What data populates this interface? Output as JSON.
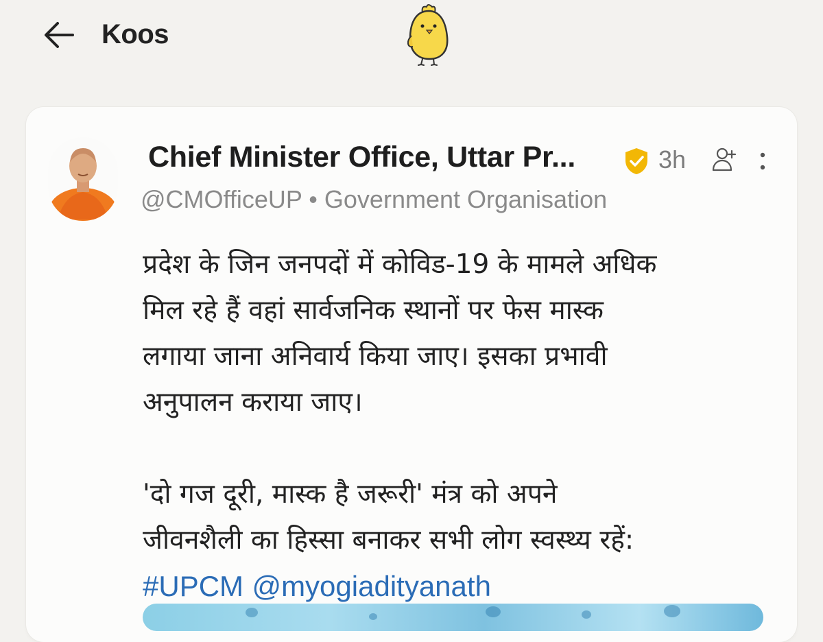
{
  "header": {
    "title": "Koos",
    "back_icon": "arrow-left-icon",
    "logo_icon": "koo-yellow-bird-logo"
  },
  "post": {
    "author_name": "Chief Minister Office, Uttar Pr...",
    "verified_icon": "verified-badge-icon",
    "time": "3h",
    "follow_icon": "add-person-icon",
    "more_icon": "more-vertical-icon",
    "handle": "@CMOfficeUP",
    "separator": "•",
    "category": "Government Organisation",
    "body_lines_1": [
      "प्रदेश के जिन जनपदों में कोविड-19 के मामले अधिक",
      "मिल रहे हैं वहां सार्वजनिक स्थानों पर फेस मास्क",
      "लगाया जाना अनिवार्य किया जाए। इसका प्रभावी",
      "अनुपालन कराया जाए।"
    ],
    "body_lines_2": [
      "'दो गज दूरी, मास्क है जरूरी' मंत्र को अपने",
      "जीवनशैली का हिस्सा बनाकर सभी लोग स्वस्थ्य रहें:"
    ],
    "hashtag": "#UPCM",
    "mention": "@myogiadityanath"
  },
  "colors": {
    "background": "#f3f2ef",
    "card": "#fcfcfb",
    "link": "#2b6cb6",
    "verified": "#f2b705",
    "logo_yellow": "#f7d84a",
    "muted_text": "#8a8a8a"
  }
}
